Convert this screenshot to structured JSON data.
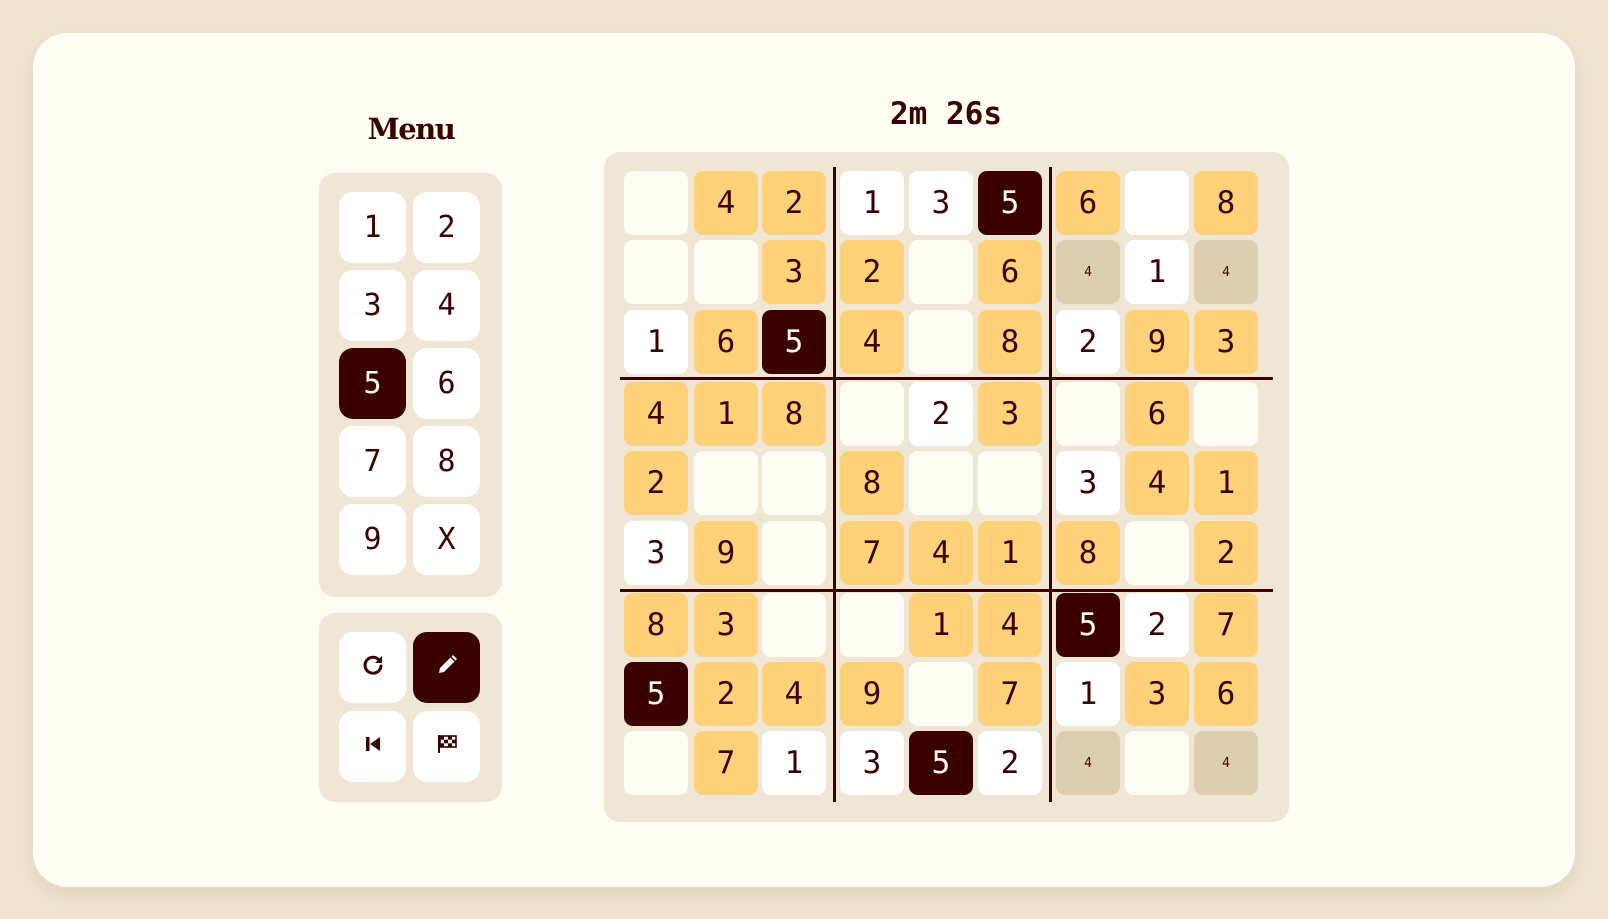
{
  "menu": {
    "title": "Menu"
  },
  "timer": "2m 26s",
  "numpad": {
    "keys": [
      "1",
      "2",
      "3",
      "4",
      "5",
      "6",
      "7",
      "8",
      "9",
      "X"
    ],
    "selected": "5"
  },
  "tools": [
    {
      "name": "redo-button",
      "icon": "redo-icon",
      "active": false
    },
    {
      "name": "pencil-button",
      "icon": "pencil-icon",
      "active": true
    },
    {
      "name": "restart-button",
      "icon": "skip-back-icon",
      "active": false
    },
    {
      "name": "finish-button",
      "icon": "checkered-flag-icon",
      "active": false
    }
  ],
  "board": {
    "rows": [
      [
        {
          "v": "",
          "s": "empty"
        },
        {
          "v": "4",
          "s": "filled"
        },
        {
          "v": "2",
          "s": "filled"
        },
        {
          "v": "1",
          "s": "given"
        },
        {
          "v": "3",
          "s": "given"
        },
        {
          "v": "5",
          "s": "sel"
        },
        {
          "v": "6",
          "s": "filled"
        },
        {
          "v": "",
          "s": "given"
        },
        {
          "v": "8",
          "s": "filled"
        }
      ],
      [
        {
          "v": "",
          "s": "empty"
        },
        {
          "v": "",
          "s": "empty"
        },
        {
          "v": "3",
          "s": "filled"
        },
        {
          "v": "2",
          "s": "filled"
        },
        {
          "v": "",
          "s": "empty"
        },
        {
          "v": "6",
          "s": "filled"
        },
        {
          "v": "4",
          "s": "note"
        },
        {
          "v": "1",
          "s": "given"
        },
        {
          "v": "4",
          "s": "note"
        }
      ],
      [
        {
          "v": "1",
          "s": "given"
        },
        {
          "v": "6",
          "s": "filled"
        },
        {
          "v": "5",
          "s": "sel"
        },
        {
          "v": "4",
          "s": "filled"
        },
        {
          "v": "",
          "s": "empty"
        },
        {
          "v": "8",
          "s": "filled"
        },
        {
          "v": "2",
          "s": "given"
        },
        {
          "v": "9",
          "s": "filled"
        },
        {
          "v": "3",
          "s": "filled"
        }
      ],
      [
        {
          "v": "4",
          "s": "filled"
        },
        {
          "v": "1",
          "s": "filled"
        },
        {
          "v": "8",
          "s": "filled"
        },
        {
          "v": "",
          "s": "empty"
        },
        {
          "v": "2",
          "s": "given"
        },
        {
          "v": "3",
          "s": "filled"
        },
        {
          "v": "",
          "s": "empty"
        },
        {
          "v": "6",
          "s": "filled"
        },
        {
          "v": "",
          "s": "empty"
        }
      ],
      [
        {
          "v": "2",
          "s": "filled"
        },
        {
          "v": "",
          "s": "empty"
        },
        {
          "v": "",
          "s": "empty"
        },
        {
          "v": "8",
          "s": "filled"
        },
        {
          "v": "",
          "s": "empty"
        },
        {
          "v": "",
          "s": "empty"
        },
        {
          "v": "3",
          "s": "given"
        },
        {
          "v": "4",
          "s": "filled"
        },
        {
          "v": "1",
          "s": "filled"
        }
      ],
      [
        {
          "v": "3",
          "s": "given"
        },
        {
          "v": "9",
          "s": "filled"
        },
        {
          "v": "",
          "s": "empty"
        },
        {
          "v": "7",
          "s": "filled"
        },
        {
          "v": "4",
          "s": "filled"
        },
        {
          "v": "1",
          "s": "filled"
        },
        {
          "v": "8",
          "s": "filled"
        },
        {
          "v": "",
          "s": "empty"
        },
        {
          "v": "2",
          "s": "filled"
        }
      ],
      [
        {
          "v": "8",
          "s": "filled"
        },
        {
          "v": "3",
          "s": "filled"
        },
        {
          "v": "",
          "s": "empty"
        },
        {
          "v": "",
          "s": "empty"
        },
        {
          "v": "1",
          "s": "filled"
        },
        {
          "v": "4",
          "s": "filled"
        },
        {
          "v": "5",
          "s": "sel"
        },
        {
          "v": "2",
          "s": "given"
        },
        {
          "v": "7",
          "s": "filled"
        }
      ],
      [
        {
          "v": "5",
          "s": "sel"
        },
        {
          "v": "2",
          "s": "filled"
        },
        {
          "v": "4",
          "s": "filled"
        },
        {
          "v": "9",
          "s": "filled"
        },
        {
          "v": "",
          "s": "empty"
        },
        {
          "v": "7",
          "s": "filled"
        },
        {
          "v": "1",
          "s": "given"
        },
        {
          "v": "3",
          "s": "filled"
        },
        {
          "v": "6",
          "s": "filled"
        }
      ],
      [
        {
          "v": "",
          "s": "empty"
        },
        {
          "v": "7",
          "s": "filled"
        },
        {
          "v": "1",
          "s": "given"
        },
        {
          "v": "3",
          "s": "given"
        },
        {
          "v": "5",
          "s": "sel"
        },
        {
          "v": "2",
          "s": "given"
        },
        {
          "v": "4",
          "s": "note"
        },
        {
          "v": "",
          "s": "empty"
        },
        {
          "v": "4",
          "s": "note"
        }
      ]
    ]
  },
  "colors": {
    "background": "#efe4d2",
    "card": "#fffdf4",
    "panel": "#efe6d6",
    "accent_dark": "#3b0000",
    "filled": "#ffd27a",
    "note": "#ddceb0",
    "given": "#ffffff"
  }
}
